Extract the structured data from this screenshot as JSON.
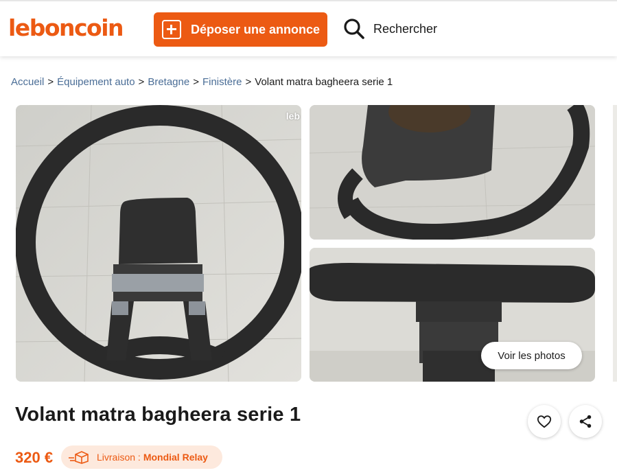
{
  "header": {
    "logo": "leboncoin",
    "deposit_label": "Déposer une annonce",
    "search_label": "Rechercher"
  },
  "breadcrumb": {
    "items": [
      "Accueil",
      "Équipement auto",
      "Bretagne",
      "Finistère"
    ],
    "current": "Volant matra bagheera serie 1",
    "separator": ">"
  },
  "gallery": {
    "watermark": "leb",
    "see_photos_label": "Voir les photos"
  },
  "ad": {
    "title": "Volant matra bagheera serie 1",
    "price": "320 €",
    "delivery_prefix": "Livraison :",
    "delivery_carrier": "Mondial Relay"
  },
  "icons": {
    "deposit": "plus-square-icon",
    "search": "magnifier-icon",
    "favorite": "heart-icon",
    "share": "share-icon",
    "delivery": "delivery-truck-icon"
  },
  "colors": {
    "brand": "#ec5a13",
    "link": "#4a6d96",
    "badge_bg": "#fde9dd"
  }
}
